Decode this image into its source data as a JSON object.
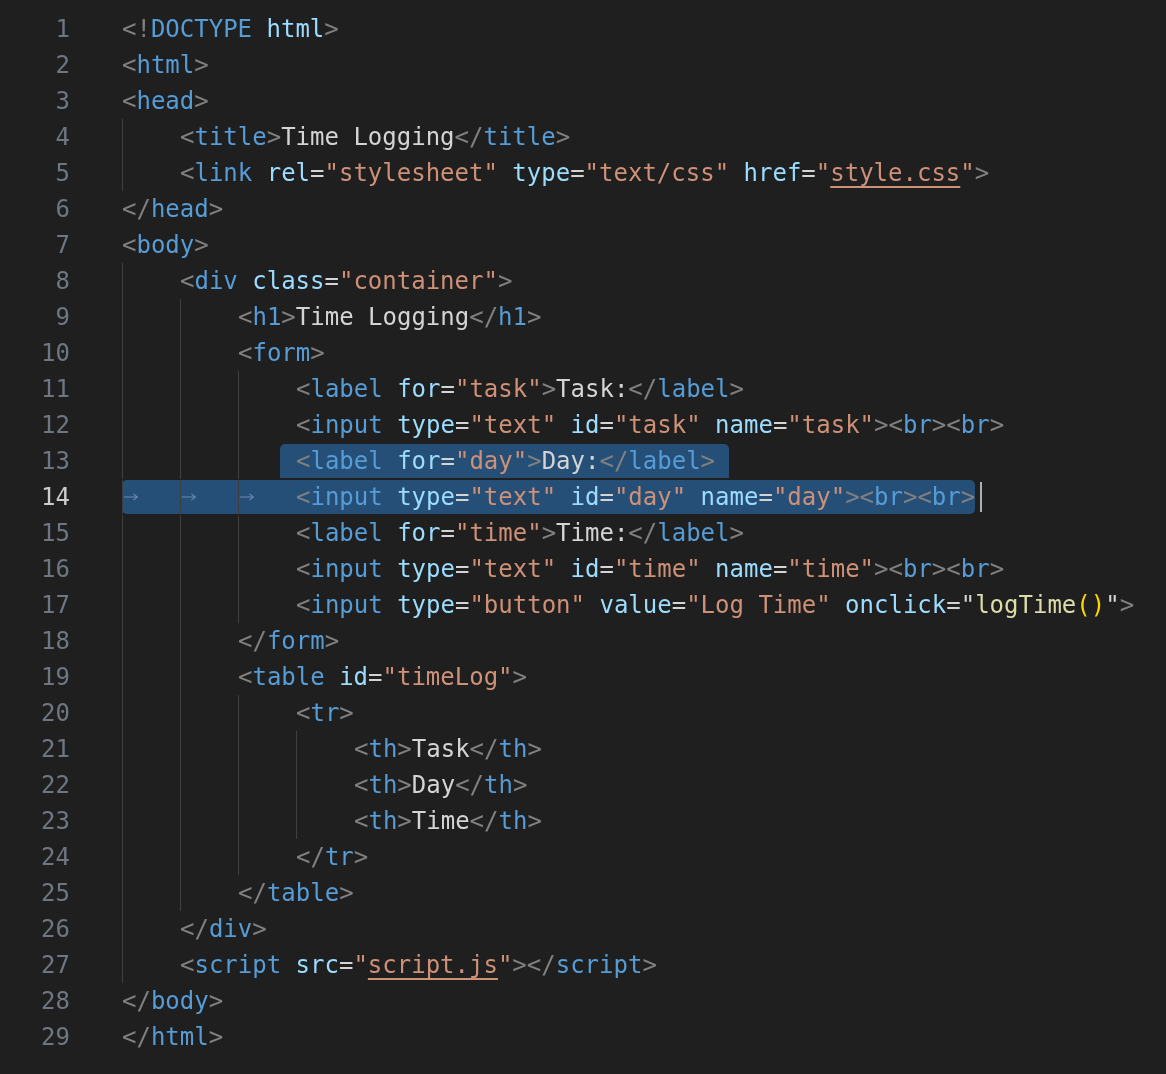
{
  "editor": {
    "lines": [
      {
        "number": "1",
        "selected": false,
        "current": false,
        "tokens": [
          {
            "kind": "punct",
            "text": "<!"
          },
          {
            "kind": "tag",
            "text": "DOCTYPE"
          },
          {
            "kind": "attr",
            "text": " html"
          },
          {
            "kind": "punct",
            "text": ">"
          }
        ]
      },
      {
        "number": "2",
        "selected": false,
        "current": false,
        "tokens": [
          {
            "kind": "punct",
            "text": "<"
          },
          {
            "kind": "tag",
            "text": "html"
          },
          {
            "kind": "punct",
            "text": ">"
          }
        ]
      },
      {
        "number": "3",
        "selected": false,
        "current": false,
        "tokens": [
          {
            "kind": "punct",
            "text": "<"
          },
          {
            "kind": "tag",
            "text": "head"
          },
          {
            "kind": "punct",
            "text": ">"
          }
        ],
        "children": [
          {
            "number": "4",
            "selected": false,
            "current": false,
            "tokens": [
              {
                "kind": "punct",
                "text": "<"
              },
              {
                "kind": "tag",
                "text": "title"
              },
              {
                "kind": "punct",
                "text": ">"
              },
              {
                "kind": "text",
                "text": "Time Logging"
              },
              {
                "kind": "punct",
                "text": "</"
              },
              {
                "kind": "tag",
                "text": "title"
              },
              {
                "kind": "punct",
                "text": ">"
              }
            ]
          },
          {
            "number": "5",
            "selected": false,
            "current": false,
            "tokens": [
              {
                "kind": "punct",
                "text": "<"
              },
              {
                "kind": "tag",
                "text": "link"
              },
              {
                "kind": "attr",
                "text": " rel"
              },
              {
                "kind": "text",
                "text": "="
              },
              {
                "kind": "string",
                "text": "\"stylesheet\""
              },
              {
                "kind": "attr",
                "text": " type"
              },
              {
                "kind": "text",
                "text": "="
              },
              {
                "kind": "string",
                "text": "\"text/css\""
              },
              {
                "kind": "attr",
                "text": " href"
              },
              {
                "kind": "text",
                "text": "="
              },
              {
                "kind": "string",
                "text": "\""
              },
              {
                "kind": "link",
                "text": "style.css"
              },
              {
                "kind": "string",
                "text": "\""
              },
              {
                "kind": "punct",
                "text": ">"
              }
            ]
          }
        ]
      },
      {
        "number": "6",
        "selected": false,
        "current": false,
        "tokens": [
          {
            "kind": "punct",
            "text": "</"
          },
          {
            "kind": "tag",
            "text": "head"
          },
          {
            "kind": "punct",
            "text": ">"
          }
        ]
      },
      {
        "number": "7",
        "selected": false,
        "current": false,
        "tokens": [
          {
            "kind": "punct",
            "text": "<"
          },
          {
            "kind": "tag",
            "text": "body"
          },
          {
            "kind": "punct",
            "text": ">"
          }
        ],
        "children": [
          {
            "number": "8",
            "selected": false,
            "current": false,
            "tokens": [
              {
                "kind": "punct",
                "text": "<"
              },
              {
                "kind": "tag",
                "text": "div"
              },
              {
                "kind": "attr",
                "text": " class"
              },
              {
                "kind": "text",
                "text": "="
              },
              {
                "kind": "string",
                "text": "\"container\""
              },
              {
                "kind": "punct",
                "text": ">"
              }
            ],
            "children": [
              {
                "number": "9",
                "selected": false,
                "current": false,
                "tokens": [
                  {
                    "kind": "punct",
                    "text": "<"
                  },
                  {
                    "kind": "tag",
                    "text": "h1"
                  },
                  {
                    "kind": "punct",
                    "text": ">"
                  },
                  {
                    "kind": "text",
                    "text": "Time Logging"
                  },
                  {
                    "kind": "punct",
                    "text": "</"
                  },
                  {
                    "kind": "tag",
                    "text": "h1"
                  },
                  {
                    "kind": "punct",
                    "text": ">"
                  }
                ]
              },
              {
                "number": "10",
                "selected": false,
                "current": false,
                "tokens": [
                  {
                    "kind": "punct",
                    "text": "<"
                  },
                  {
                    "kind": "tag",
                    "text": "form"
                  },
                  {
                    "kind": "punct",
                    "text": ">"
                  }
                ],
                "children": [
                  {
                    "number": "11",
                    "selected": false,
                    "current": false,
                    "tokens": [
                      {
                        "kind": "punct",
                        "text": "<"
                      },
                      {
                        "kind": "tag",
                        "text": "label"
                      },
                      {
                        "kind": "attr",
                        "text": " for"
                      },
                      {
                        "kind": "text",
                        "text": "="
                      },
                      {
                        "kind": "string",
                        "text": "\"task\""
                      },
                      {
                        "kind": "punct",
                        "text": ">"
                      },
                      {
                        "kind": "text",
                        "text": "Task:"
                      },
                      {
                        "kind": "punct",
                        "text": "</"
                      },
                      {
                        "kind": "tag",
                        "text": "label"
                      },
                      {
                        "kind": "punct",
                        "text": ">"
                      }
                    ]
                  },
                  {
                    "number": "12",
                    "selected": false,
                    "current": false,
                    "tokens": [
                      {
                        "kind": "punct",
                        "text": "<"
                      },
                      {
                        "kind": "tag",
                        "text": "input"
                      },
                      {
                        "kind": "attr",
                        "text": " type"
                      },
                      {
                        "kind": "text",
                        "text": "="
                      },
                      {
                        "kind": "string",
                        "text": "\"text\""
                      },
                      {
                        "kind": "attr",
                        "text": " id"
                      },
                      {
                        "kind": "text",
                        "text": "="
                      },
                      {
                        "kind": "string",
                        "text": "\"task\""
                      },
                      {
                        "kind": "attr",
                        "text": " name"
                      },
                      {
                        "kind": "text",
                        "text": "="
                      },
                      {
                        "kind": "string",
                        "text": "\"task\""
                      },
                      {
                        "kind": "punct",
                        "text": "><"
                      },
                      {
                        "kind": "tag",
                        "text": "br"
                      },
                      {
                        "kind": "punct",
                        "text": "><"
                      },
                      {
                        "kind": "tag",
                        "text": "br"
                      },
                      {
                        "kind": "punct",
                        "text": ">"
                      }
                    ]
                  },
                  {
                    "number": "13",
                    "selected": true,
                    "current": false,
                    "tokens": [
                      {
                        "kind": "punct",
                        "text": "<"
                      },
                      {
                        "kind": "tag",
                        "text": "label"
                      },
                      {
                        "kind": "attr",
                        "text": " for"
                      },
                      {
                        "kind": "text",
                        "text": "="
                      },
                      {
                        "kind": "string",
                        "text": "\"day\""
                      },
                      {
                        "kind": "punct",
                        "text": ">"
                      },
                      {
                        "kind": "text",
                        "text": "Day:"
                      },
                      {
                        "kind": "punct",
                        "text": "</"
                      },
                      {
                        "kind": "tag",
                        "text": "label"
                      },
                      {
                        "kind": "punct",
                        "text": ">"
                      }
                    ]
                  },
                  {
                    "number": "14",
                    "selected": true,
                    "current": true,
                    "tokens": [
                      {
                        "kind": "punct",
                        "text": "<"
                      },
                      {
                        "kind": "tag",
                        "text": "input"
                      },
                      {
                        "kind": "attr",
                        "text": " type"
                      },
                      {
                        "kind": "text",
                        "text": "="
                      },
                      {
                        "kind": "string",
                        "text": "\"text\""
                      },
                      {
                        "kind": "attr",
                        "text": " id"
                      },
                      {
                        "kind": "text",
                        "text": "="
                      },
                      {
                        "kind": "string",
                        "text": "\"day\""
                      },
                      {
                        "kind": "attr",
                        "text": " name"
                      },
                      {
                        "kind": "text",
                        "text": "="
                      },
                      {
                        "kind": "string",
                        "text": "\"day\""
                      },
                      {
                        "kind": "punct",
                        "text": "><"
                      },
                      {
                        "kind": "tag",
                        "text": "br"
                      },
                      {
                        "kind": "punct",
                        "text": "><"
                      },
                      {
                        "kind": "tag",
                        "text": "br"
                      },
                      {
                        "kind": "punct",
                        "text": ">"
                      }
                    ]
                  },
                  {
                    "number": "15",
                    "selected": false,
                    "current": false,
                    "tokens": [
                      {
                        "kind": "punct",
                        "text": "<"
                      },
                      {
                        "kind": "tag",
                        "text": "label"
                      },
                      {
                        "kind": "attr",
                        "text": " for"
                      },
                      {
                        "kind": "text",
                        "text": "="
                      },
                      {
                        "kind": "string",
                        "text": "\"time\""
                      },
                      {
                        "kind": "punct",
                        "text": ">"
                      },
                      {
                        "kind": "text",
                        "text": "Time:"
                      },
                      {
                        "kind": "punct",
                        "text": "</"
                      },
                      {
                        "kind": "tag",
                        "text": "label"
                      },
                      {
                        "kind": "punct",
                        "text": ">"
                      }
                    ]
                  },
                  {
                    "number": "16",
                    "selected": false,
                    "current": false,
                    "tokens": [
                      {
                        "kind": "punct",
                        "text": "<"
                      },
                      {
                        "kind": "tag",
                        "text": "input"
                      },
                      {
                        "kind": "attr",
                        "text": " type"
                      },
                      {
                        "kind": "text",
                        "text": "="
                      },
                      {
                        "kind": "string",
                        "text": "\"text\""
                      },
                      {
                        "kind": "attr",
                        "text": " id"
                      },
                      {
                        "kind": "text",
                        "text": "="
                      },
                      {
                        "kind": "string",
                        "text": "\"time\""
                      },
                      {
                        "kind": "attr",
                        "text": " name"
                      },
                      {
                        "kind": "text",
                        "text": "="
                      },
                      {
                        "kind": "string",
                        "text": "\"time\""
                      },
                      {
                        "kind": "punct",
                        "text": "><"
                      },
                      {
                        "kind": "tag",
                        "text": "br"
                      },
                      {
                        "kind": "punct",
                        "text": "><"
                      },
                      {
                        "kind": "tag",
                        "text": "br"
                      },
                      {
                        "kind": "punct",
                        "text": ">"
                      }
                    ]
                  },
                  {
                    "number": "17",
                    "selected": false,
                    "current": false,
                    "tokens": [
                      {
                        "kind": "punct",
                        "text": "<"
                      },
                      {
                        "kind": "tag",
                        "text": "input"
                      },
                      {
                        "kind": "attr",
                        "text": " type"
                      },
                      {
                        "kind": "text",
                        "text": "="
                      },
                      {
                        "kind": "string",
                        "text": "\"button\""
                      },
                      {
                        "kind": "attr",
                        "text": " value"
                      },
                      {
                        "kind": "text",
                        "text": "="
                      },
                      {
                        "kind": "string",
                        "text": "\"Log Time\""
                      },
                      {
                        "kind": "attr",
                        "text": " onclick"
                      },
                      {
                        "kind": "text",
                        "text": "=\""
                      },
                      {
                        "kind": "function",
                        "text": "logTime"
                      },
                      {
                        "kind": "bracket",
                        "text": "()"
                      },
                      {
                        "kind": "text",
                        "text": "\""
                      },
                      {
                        "kind": "punct",
                        "text": ">"
                      }
                    ]
                  }
                ]
              },
              {
                "number": "18",
                "selected": false,
                "current": false,
                "tokens": [
                  {
                    "kind": "punct",
                    "text": "</"
                  },
                  {
                    "kind": "tag",
                    "text": "form"
                  },
                  {
                    "kind": "punct",
                    "text": ">"
                  }
                ]
              },
              {
                "number": "19",
                "selected": false,
                "current": false,
                "tokens": [
                  {
                    "kind": "punct",
                    "text": "<"
                  },
                  {
                    "kind": "tag",
                    "text": "table"
                  },
                  {
                    "kind": "attr",
                    "text": " id"
                  },
                  {
                    "kind": "text",
                    "text": "="
                  },
                  {
                    "kind": "string",
                    "text": "\"timeLog\""
                  },
                  {
                    "kind": "punct",
                    "text": ">"
                  }
                ],
                "children": [
                  {
                    "number": "20",
                    "selected": false,
                    "current": false,
                    "tokens": [
                      {
                        "kind": "punct",
                        "text": "<"
                      },
                      {
                        "kind": "tag",
                        "text": "tr"
                      },
                      {
                        "kind": "punct",
                        "text": ">"
                      }
                    ],
                    "children": [
                      {
                        "number": "21",
                        "selected": false,
                        "current": false,
                        "tokens": [
                          {
                            "kind": "punct",
                            "text": "<"
                          },
                          {
                            "kind": "tag",
                            "text": "th"
                          },
                          {
                            "kind": "punct",
                            "text": ">"
                          },
                          {
                            "kind": "text",
                            "text": "Task"
                          },
                          {
                            "kind": "punct",
                            "text": "</"
                          },
                          {
                            "kind": "tag",
                            "text": "th"
                          },
                          {
                            "kind": "punct",
                            "text": ">"
                          }
                        ]
                      },
                      {
                        "number": "22",
                        "selected": false,
                        "current": false,
                        "tokens": [
                          {
                            "kind": "punct",
                            "text": "<"
                          },
                          {
                            "kind": "tag",
                            "text": "th"
                          },
                          {
                            "kind": "punct",
                            "text": ">"
                          },
                          {
                            "kind": "text",
                            "text": "Day"
                          },
                          {
                            "kind": "punct",
                            "text": "</"
                          },
                          {
                            "kind": "tag",
                            "text": "th"
                          },
                          {
                            "kind": "punct",
                            "text": ">"
                          }
                        ]
                      },
                      {
                        "number": "23",
                        "selected": false,
                        "current": false,
                        "tokens": [
                          {
                            "kind": "punct",
                            "text": "<"
                          },
                          {
                            "kind": "tag",
                            "text": "th"
                          },
                          {
                            "kind": "punct",
                            "text": ">"
                          },
                          {
                            "kind": "text",
                            "text": "Time"
                          },
                          {
                            "kind": "punct",
                            "text": "</"
                          },
                          {
                            "kind": "tag",
                            "text": "th"
                          },
                          {
                            "kind": "punct",
                            "text": ">"
                          }
                        ]
                      }
                    ]
                  },
                  {
                    "number": "24",
                    "selected": false,
                    "current": false,
                    "tokens": [
                      {
                        "kind": "punct",
                        "text": "</"
                      },
                      {
                        "kind": "tag",
                        "text": "tr"
                      },
                      {
                        "kind": "punct",
                        "text": ">"
                      }
                    ]
                  }
                ]
              },
              {
                "number": "25",
                "selected": false,
                "current": false,
                "tokens": [
                  {
                    "kind": "punct",
                    "text": "</"
                  },
                  {
                    "kind": "tag",
                    "text": "table"
                  },
                  {
                    "kind": "punct",
                    "text": ">"
                  }
                ]
              }
            ]
          },
          {
            "number": "26",
            "selected": false,
            "current": false,
            "tokens": [
              {
                "kind": "punct",
                "text": "</"
              },
              {
                "kind": "tag",
                "text": "div"
              },
              {
                "kind": "punct",
                "text": ">"
              }
            ]
          },
          {
            "number": "27",
            "selected": false,
            "current": false,
            "tokens": [
              {
                "kind": "punct",
                "text": "<"
              },
              {
                "kind": "tag",
                "text": "script"
              },
              {
                "kind": "attr",
                "text": " src"
              },
              {
                "kind": "text",
                "text": "="
              },
              {
                "kind": "string",
                "text": "\""
              },
              {
                "kind": "link",
                "text": "script.js"
              },
              {
                "kind": "string",
                "text": "\""
              },
              {
                "kind": "punct",
                "text": "></"
              },
              {
                "kind": "tag",
                "text": "script"
              },
              {
                "kind": "punct",
                "text": ">"
              }
            ]
          }
        ]
      },
      {
        "number": "28",
        "selected": false,
        "current": false,
        "tokens": [
          {
            "kind": "punct",
            "text": "</"
          },
          {
            "kind": "tag",
            "text": "body"
          },
          {
            "kind": "punct",
            "text": ">"
          }
        ]
      },
      {
        "number": "29",
        "selected": false,
        "current": false,
        "tokens": [
          {
            "kind": "punct",
            "text": "</"
          },
          {
            "kind": "tag",
            "text": "html"
          },
          {
            "kind": "punct",
            "text": ">"
          }
        ]
      }
    ]
  }
}
